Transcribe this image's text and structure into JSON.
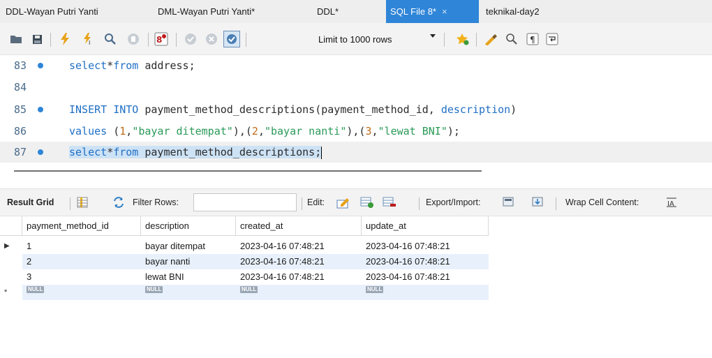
{
  "tabs": [
    {
      "label": "DDL-Wayan Putri Yanti",
      "active": false
    },
    {
      "label": "DML-Wayan Putri Yanti*",
      "active": false
    },
    {
      "label": "DDL*",
      "active": false
    },
    {
      "label": "SQL File 8*",
      "active": true,
      "close": "×"
    },
    {
      "label": "teknikal-day2",
      "active": false
    }
  ],
  "toolbar": {
    "limit_label": "Limit to 1000 rows"
  },
  "editor": {
    "lines": [
      {
        "num": "83",
        "dot": true,
        "segments": [
          {
            "t": "kw",
            "v": "select"
          },
          {
            "t": "txt",
            "v": "*"
          },
          {
            "t": "kw",
            "v": "from"
          },
          {
            "t": "txt",
            "v": " address;"
          }
        ]
      },
      {
        "num": "84",
        "dot": false,
        "segments": []
      },
      {
        "num": "85",
        "dot": true,
        "segments": [
          {
            "t": "kw",
            "v": "INSERT INTO"
          },
          {
            "t": "txt",
            "v": " payment_method_descriptions(payment_method_id, "
          },
          {
            "t": "kw",
            "v": "description"
          },
          {
            "t": "txt",
            "v": ")"
          }
        ]
      },
      {
        "num": "86",
        "dot": false,
        "segments": [
          {
            "t": "kw",
            "v": "values"
          },
          {
            "t": "txt",
            "v": " ("
          },
          {
            "t": "num",
            "v": "1"
          },
          {
            "t": "txt",
            "v": ","
          },
          {
            "t": "str",
            "v": "\"bayar ditempat\""
          },
          {
            "t": "txt",
            "v": "),("
          },
          {
            "t": "num",
            "v": "2"
          },
          {
            "t": "txt",
            "v": ","
          },
          {
            "t": "str",
            "v": "\"bayar nanti\""
          },
          {
            "t": "txt",
            "v": "),("
          },
          {
            "t": "num",
            "v": "3"
          },
          {
            "t": "txt",
            "v": ","
          },
          {
            "t": "str",
            "v": "\"lewat BNI\""
          },
          {
            "t": "txt",
            "v": ");"
          }
        ]
      },
      {
        "num": "87",
        "dot": true,
        "selected": true,
        "segments": [
          {
            "t": "kw",
            "v": "select"
          },
          {
            "t": "txt",
            "v": "*"
          },
          {
            "t": "kw",
            "v": "from"
          },
          {
            "t": "txt",
            "v": " payment_method_descriptions;"
          }
        ]
      }
    ]
  },
  "result_toolbar": {
    "result_grid": "Result Grid",
    "filter_rows": "Filter Rows:",
    "edit": "Edit:",
    "export_import": "Export/Import:",
    "wrap_cell": "Wrap Cell Content:"
  },
  "grid": {
    "columns": [
      "payment_method_id",
      "description",
      "created_at",
      "update_at"
    ],
    "rows": [
      [
        "1",
        "bayar ditempat",
        "2023-04-16 07:48:21",
        "2023-04-16 07:48:21"
      ],
      [
        "2",
        "bayar nanti",
        "2023-04-16 07:48:21",
        "2023-04-16 07:48:21"
      ],
      [
        "3",
        "lewat BNI",
        "2023-04-16 07:48:21",
        "2023-04-16 07:48:21"
      ]
    ],
    "null_label": "NULL"
  },
  "colors": {
    "accent": "#2f85d8",
    "keyword": "#1f6fc5",
    "string": "#2a9a58",
    "selection": "#cde2f5",
    "row_alt": "#e8f1fb"
  }
}
